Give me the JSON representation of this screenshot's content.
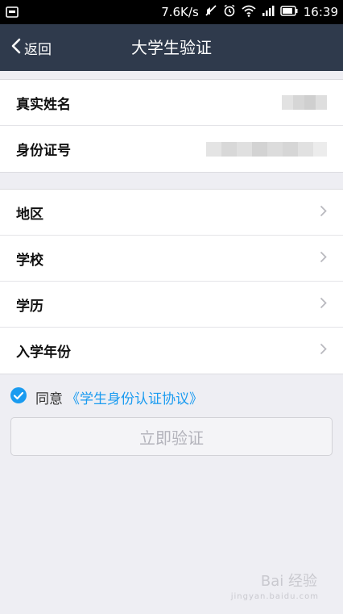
{
  "status_bar": {
    "speed": "7.6K/s",
    "time": "16:39",
    "icons": [
      "notification-image-icon",
      "mute-icon",
      "alarm-icon",
      "wifi-icon",
      "signal-icon",
      "battery-icon"
    ]
  },
  "nav": {
    "back_label": "返回",
    "title": "大学生验证"
  },
  "identity_rows": [
    {
      "label": "真实姓名"
    },
    {
      "label": "身份证号"
    }
  ],
  "info_rows": [
    {
      "label": "地区"
    },
    {
      "label": "学校"
    },
    {
      "label": "学历"
    },
    {
      "label": "入学年份"
    }
  ],
  "agreement": {
    "checked": true,
    "text": "同意",
    "link": "《学生身份认证协议》"
  },
  "verify_button": "立即验证",
  "watermark": {
    "brand": "Bai 经验",
    "url": "jingyan.baidu.com"
  },
  "colors": {
    "nav_bg": "#2f3a4c",
    "accent": "#1a9bf0",
    "page_bg": "#eeeef3"
  }
}
